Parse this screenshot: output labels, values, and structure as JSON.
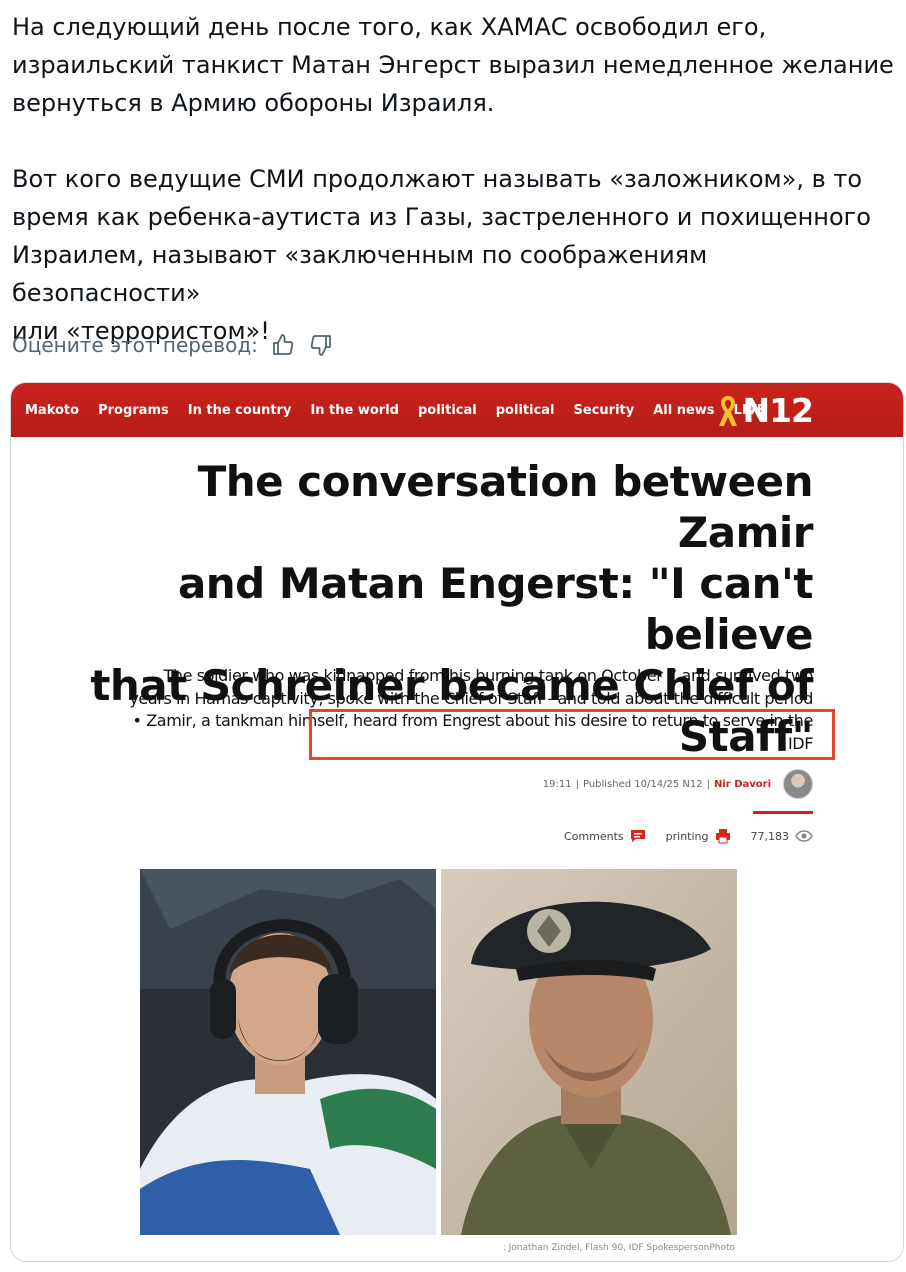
{
  "post": {
    "paragraph_1_lines": [
      "На следующий день после того, как ХАМАС освободил его,",
      "израильский танкист Матан Энгерст выразил немедленное желание",
      "вернуться в Армию обороны Израиля."
    ],
    "paragraph_2_lines": [
      "Вот кого ведущие СМИ продолжают называть «заложником», в то",
      "время как ребенка-аутиста из Газы, застреленного и похищенного",
      "Израилем, называют «заключенным по соображениям безопасности»",
      "или «террористом»!"
    ]
  },
  "translation_rating": {
    "label": "Оцените этот перевод:",
    "thumbs_up_icon": "thumbs-up-icon",
    "thumbs_down_icon": "thumbs-down-icon"
  },
  "article": {
    "nav_items": [
      "Makoto",
      "Programs",
      "In the country",
      "In the world",
      "political",
      "political",
      "Security",
      "All news",
      "LIVE"
    ],
    "logo_text": "N12",
    "brand_color": "#c8231c",
    "headline_lines": [
      "The conversation between Zamir",
      "and Matan Engerst: \"I can't believe",
      "that Schreiner became Chief of",
      "Staff\""
    ],
    "subhead_lines": [
      "The soldier who was kidnapped from his burning tank on October 7 and survived two",
      "years in Hamas captivity, spoke with the Chief of Staff - and told about the difficult period",
      "• Zamir, a tankman himself, heard from Engrest about his desire to return to serve in the",
      "IDF"
    ],
    "highlight_color": "#e5442e",
    "byline": {
      "time": "19:11",
      "published": "Published 10/14/25 N12",
      "separator": "|",
      "author": "Nir Davori"
    },
    "actions": {
      "comments_label": "Comments",
      "printing_label": "printing",
      "views": "77,183"
    },
    "photo_credit": ": Jonathan Zindel, Flash 90, IDF SpokespersonPhoto"
  }
}
